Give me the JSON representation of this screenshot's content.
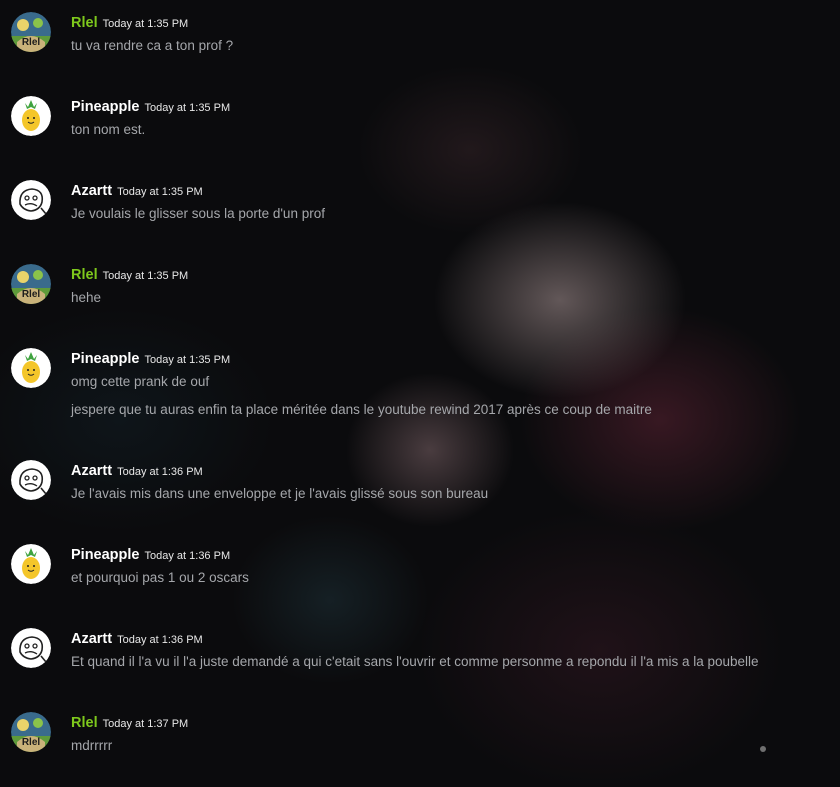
{
  "colors": {
    "rlel_name": "#7ec81c",
    "default_name": "#ffffff",
    "text": "#a5a7ab"
  },
  "messages": [
    {
      "author": "Rlel",
      "avatar": "rlel-avatar-icon",
      "timestamp": "Today at 1:35 PM",
      "lines": [
        "tu va rendre ca a ton prof ?"
      ]
    },
    {
      "author": "Pineapple",
      "avatar": "pineapple-avatar-icon",
      "timestamp": "Today at 1:35 PM",
      "lines": [
        "ton nom est."
      ]
    },
    {
      "author": "Azartt",
      "avatar": "azartt-avatar-icon",
      "timestamp": "Today at 1:35 PM",
      "lines": [
        "Je voulais le glisser sous la porte d'un prof"
      ]
    },
    {
      "author": "Rlel",
      "avatar": "rlel-avatar-icon",
      "timestamp": "Today at 1:35 PM",
      "lines": [
        "hehe"
      ]
    },
    {
      "author": "Pineapple",
      "avatar": "pineapple-avatar-icon",
      "timestamp": "Today at 1:35 PM",
      "lines": [
        "omg cette prank de ouf",
        "jespere que tu auras enfin ta place méritée dans le youtube rewind 2017 après ce coup de maitre"
      ]
    },
    {
      "author": "Azartt",
      "avatar": "azartt-avatar-icon",
      "timestamp": "Today at 1:36 PM",
      "lines": [
        "Je l'avais mis dans une enveloppe et je l'avais glissé sous son bureau"
      ]
    },
    {
      "author": "Pineapple",
      "avatar": "pineapple-avatar-icon",
      "timestamp": "Today at 1:36 PM",
      "lines": [
        "et pourquoi pas 1 ou 2 oscars"
      ]
    },
    {
      "author": "Azartt",
      "avatar": "azartt-avatar-icon",
      "timestamp": "Today at 1:36 PM",
      "lines": [
        "Et quand il l'a vu il l'a juste demandé a qui c'etait sans l'ouvrir et comme personme a repondu il l'a mis a la poubelle"
      ]
    },
    {
      "author": "Rlel",
      "avatar": "rlel-avatar-icon",
      "timestamp": "Today at 1:37 PM",
      "lines": [
        "mdrrrrr"
      ]
    }
  ]
}
